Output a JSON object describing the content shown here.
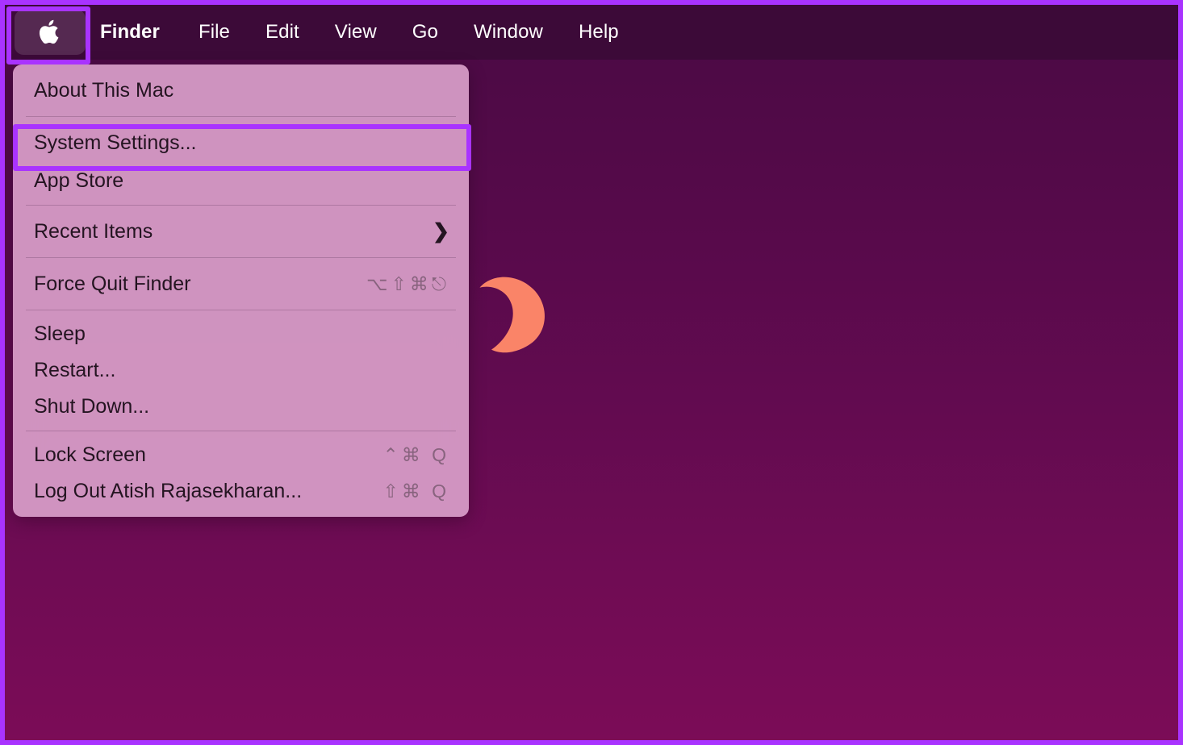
{
  "menubar": {
    "apple_icon": "apple-logo-icon",
    "items": [
      {
        "label": "Finder",
        "bold": true
      },
      {
        "label": "File",
        "bold": false
      },
      {
        "label": "Edit",
        "bold": false
      },
      {
        "label": "View",
        "bold": false
      },
      {
        "label": "Go",
        "bold": false
      },
      {
        "label": "Window",
        "bold": false
      },
      {
        "label": "Help",
        "bold": false
      }
    ]
  },
  "apple_menu": {
    "rows": [
      {
        "label": "About This Mac",
        "shortcut": "",
        "chevron": ""
      },
      {
        "label": "System Settings...",
        "shortcut": "",
        "chevron": ""
      },
      {
        "label": "App Store",
        "shortcut": "",
        "chevron": ""
      },
      {
        "label": "Recent Items",
        "shortcut": "",
        "chevron": "❯"
      },
      {
        "label": "Force Quit Finder",
        "shortcut": "⌥⇧⌘⎋",
        "chevron": ""
      },
      {
        "label": "Sleep",
        "shortcut": "",
        "chevron": ""
      },
      {
        "label": "Restart...",
        "shortcut": "",
        "chevron": ""
      },
      {
        "label": "Shut Down...",
        "shortcut": "",
        "chevron": ""
      },
      {
        "label": "Lock Screen",
        "shortcut": "⌃⌘ Q",
        "chevron": ""
      },
      {
        "label": "Log Out Atish Rajasekharan...",
        "shortcut": "⇧⌘ Q",
        "chevron": ""
      }
    ]
  },
  "desktop": {
    "moon_icon": "crescent-moon-icon"
  },
  "colors": {
    "annotation": "#a933ff",
    "menubar_bg": "#3c0a38",
    "menu_bg": "#d89ec8",
    "moon": "#fa8468",
    "wallpaper_top": "#4a0a44",
    "wallpaper_bottom": "#7b0c57"
  }
}
